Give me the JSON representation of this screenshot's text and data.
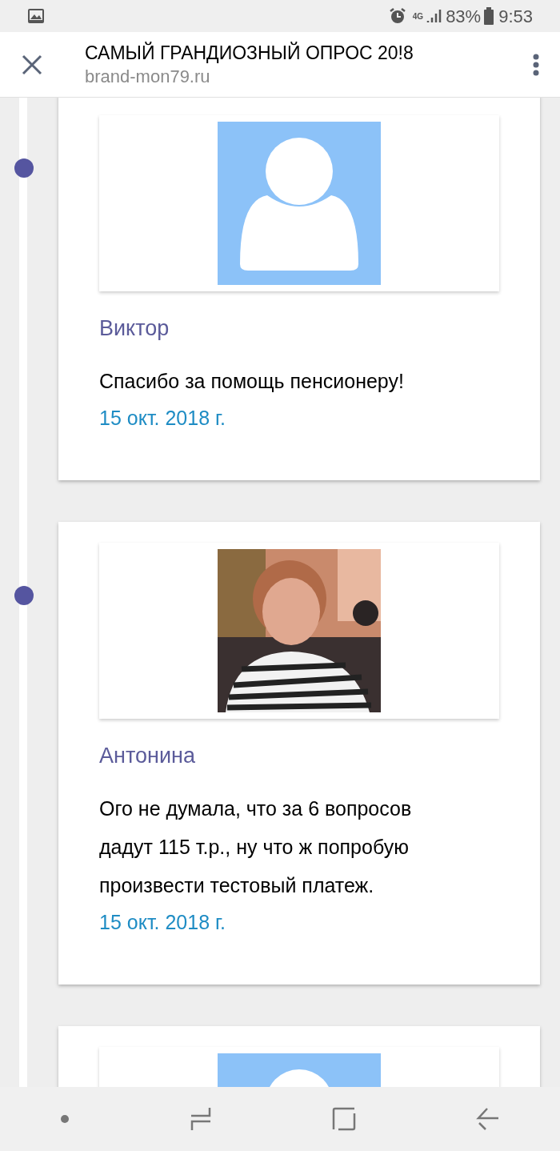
{
  "status_bar": {
    "network": "4G",
    "battery": "83%",
    "time": "9:53"
  },
  "header": {
    "title": "САМЫЙ ГРАНДИОЗНЫЙ ОПРОС 20!8",
    "url": "brand-mon79.ru"
  },
  "comments": [
    {
      "kind": "placeholder",
      "name": "Виктор",
      "text": "Спасибо за помощь пенсионеру!",
      "date": "15 окт. 2018 г."
    },
    {
      "kind": "picture",
      "name": "Антонина",
      "text": "Ого не думала, что за 6 вопросов дадут 115 т.р., ну что ж попробую произвести тестовый платеж.",
      "date": "15 окт. 2018 г."
    },
    {
      "kind": "placeholder"
    }
  ]
}
